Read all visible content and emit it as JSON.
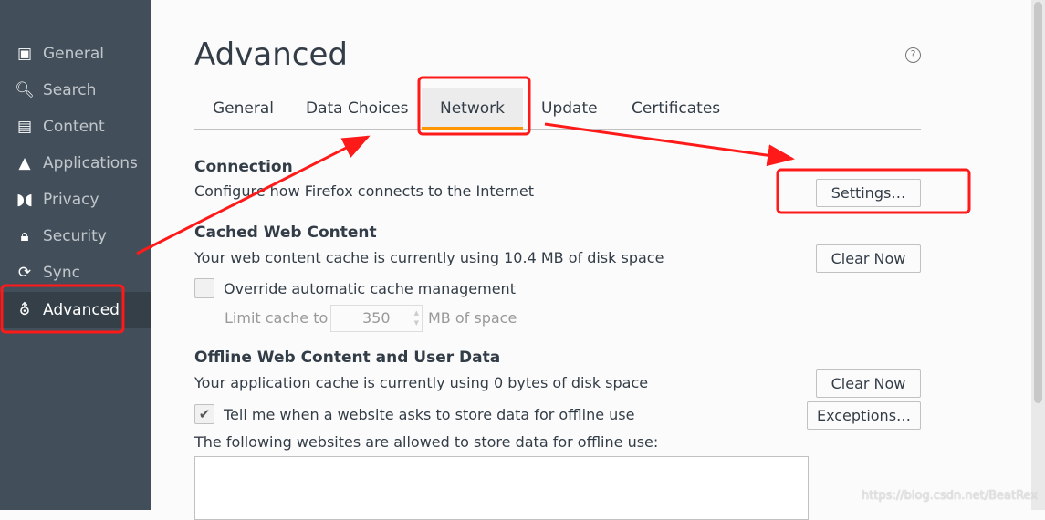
{
  "sidebar": {
    "items": [
      {
        "label": "General",
        "icon": "general-icon"
      },
      {
        "label": "Search",
        "icon": "search-icon"
      },
      {
        "label": "Content",
        "icon": "content-icon"
      },
      {
        "label": "Applications",
        "icon": "applications-icon"
      },
      {
        "label": "Privacy",
        "icon": "privacy-mask-icon"
      },
      {
        "label": "Security",
        "icon": "lock-icon"
      },
      {
        "label": "Sync",
        "icon": "sync-icon"
      },
      {
        "label": "Advanced",
        "icon": "wizard-hat-icon",
        "active": true
      }
    ]
  },
  "page": {
    "title": "Advanced",
    "help": "?"
  },
  "tabs": [
    {
      "label": "General"
    },
    {
      "label": "Data Choices"
    },
    {
      "label": "Network",
      "selected": true
    },
    {
      "label": "Update"
    },
    {
      "label": "Certificates"
    }
  ],
  "connection": {
    "heading": "Connection",
    "desc": "Configure how Firefox connects to the Internet",
    "settings": "Settings…"
  },
  "cache": {
    "heading": "Cached Web Content",
    "desc": "Your web content cache is currently using 10.4 MB of disk space",
    "clear": "Clear Now",
    "override": "Override automatic cache management",
    "override_checked": false,
    "limit_label": "Limit cache to",
    "limit_value": "350",
    "limit_unit": "MB of space"
  },
  "offline": {
    "heading": "Offline Web Content and User Data",
    "desc": "Your application cache is currently using 0 bytes of disk space",
    "clear": "Clear Now",
    "tell": "Tell me when a website asks to store data for offline use",
    "tell_checked": true,
    "exceptions": "Exceptions…",
    "allowed": "The following websites are allowed to store data for offline use:"
  },
  "watermark": "https://blog.csdn.net/BeatRex",
  "colors": {
    "sidebar": "#424f5a",
    "active": "#343f48",
    "tab_accent": "#ff9500",
    "annotation": "#ff1a1a"
  }
}
